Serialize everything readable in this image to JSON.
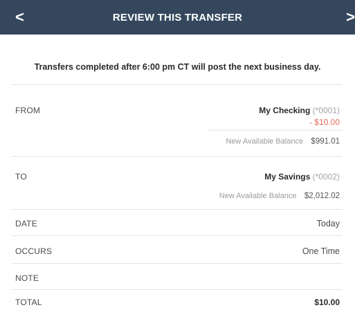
{
  "header": {
    "title": "REVIEW THIS TRANSFER",
    "back_icon": "<",
    "forward_icon": ">"
  },
  "notice": "Transfers completed after 6:00 pm CT will post the next business day.",
  "from": {
    "label": "FROM",
    "account_name": "My Checking",
    "account_mask": "(*0001)",
    "amount": "- $10.00",
    "balance_label": "New Available Balance",
    "balance_value": "$991.01"
  },
  "to": {
    "label": "TO",
    "account_name": "My Savings",
    "account_mask": "(*0002)",
    "balance_label": "New Available Balance",
    "balance_value": "$2,012.02"
  },
  "date": {
    "label": "DATE",
    "value": "Today"
  },
  "occurs": {
    "label": "OCCURS",
    "value": "One Time"
  },
  "note": {
    "label": "NOTE",
    "value": ""
  },
  "total": {
    "label": "TOTAL",
    "value": "$10.00"
  },
  "colors": {
    "header_bg": "#34475d",
    "negative_amount": "#e06a5c",
    "divider": "#e3e3e3"
  }
}
